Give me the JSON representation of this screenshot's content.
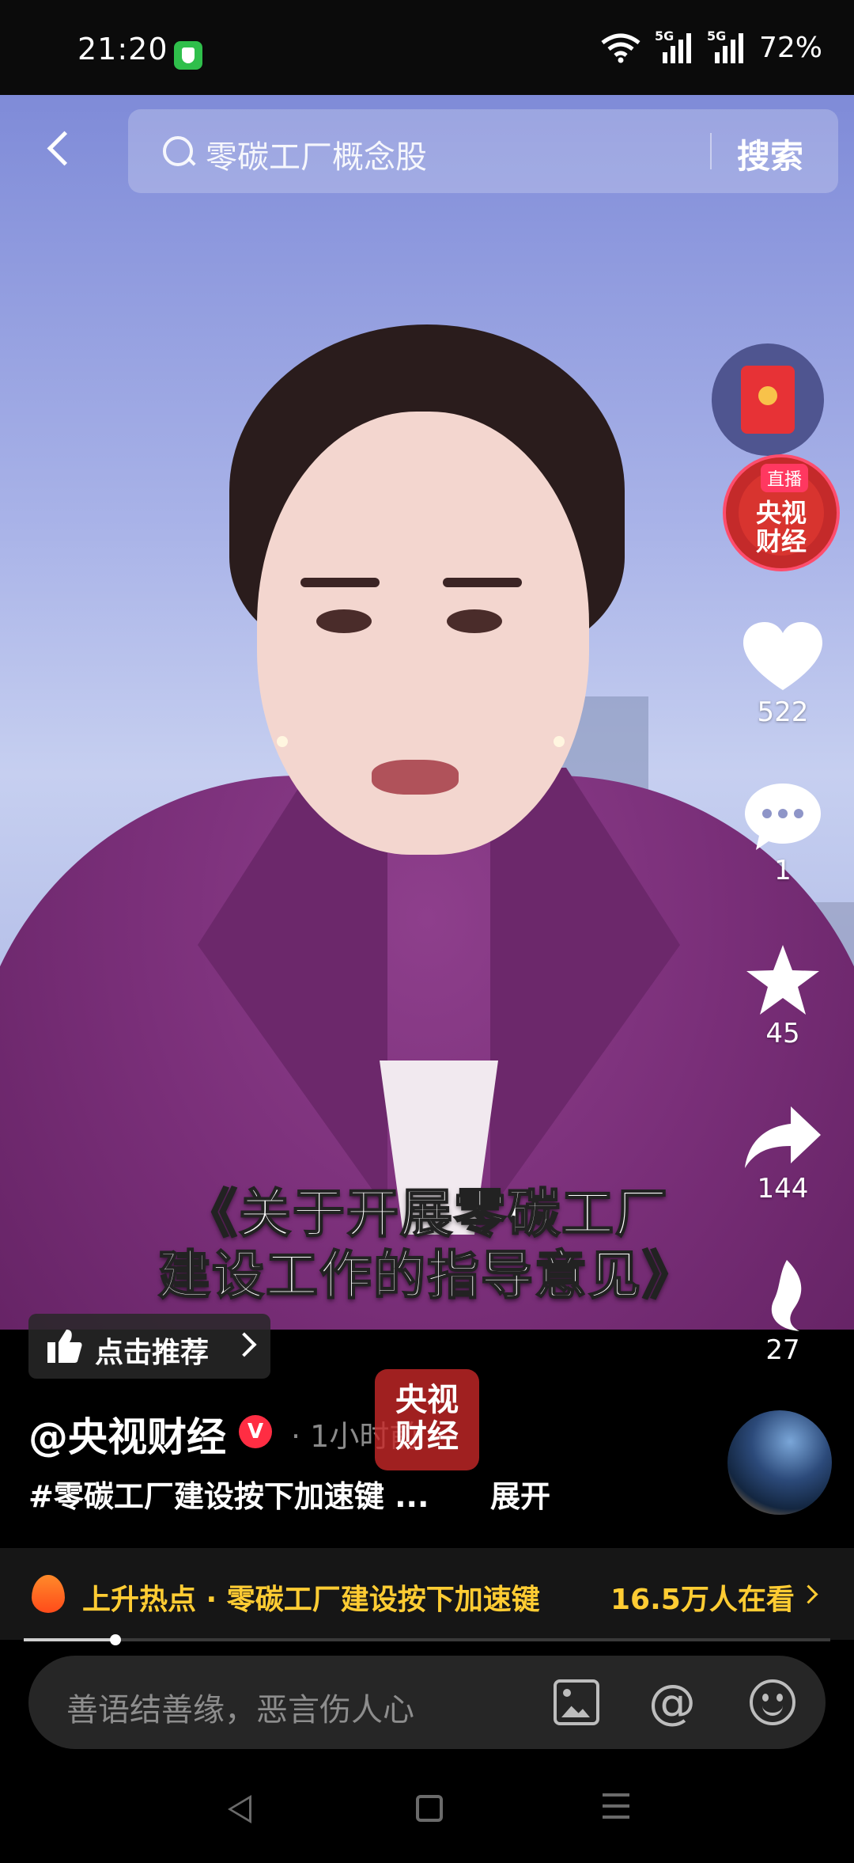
{
  "status_bar": {
    "time": "21:20",
    "network": "5G",
    "battery": "72%"
  },
  "search": {
    "query": "零碳工厂概念股",
    "button": "搜索"
  },
  "video": {
    "subtitle_line1": "《关于开展零碳工厂",
    "subtitle_line2": "建设工作的指导意见》"
  },
  "actions": {
    "live_label": "直播",
    "live_channel": "央视\n财经",
    "likes": "522",
    "comments": "1",
    "favorites": "45",
    "shares": "144",
    "extra": "27"
  },
  "recommend": {
    "label": "点击推荐"
  },
  "post": {
    "author": "@央视财经",
    "verified_mark": "V",
    "time_ago": "· 1小时前",
    "watermark": "央视\n财经",
    "hashtag": "#零碳工厂建设按下加速键 ...",
    "expand": "展开"
  },
  "hot": {
    "label": "上升热点 · 零碳工厂建设按下加速键",
    "count": "16.5万人在看"
  },
  "progress": {
    "fraction": 0.114
  },
  "comment": {
    "placeholder": "善语结善缘，恶言伤人心"
  },
  "colors": {
    "hot": "#ffcc33",
    "accent_red": "#ff2d43"
  },
  "icons": [
    "back-icon",
    "search-icon",
    "red-packet-icon",
    "heart-icon",
    "comment-icon",
    "star-icon",
    "share-icon",
    "thumb-up-icon",
    "fire-icon",
    "image-icon",
    "at-icon",
    "emoji-icon"
  ]
}
